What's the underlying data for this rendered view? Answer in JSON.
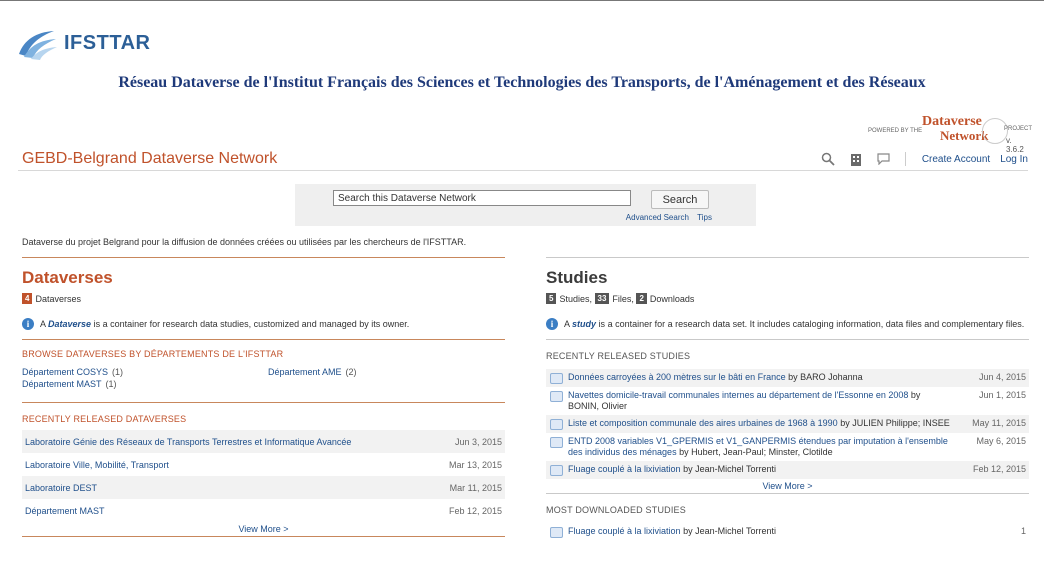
{
  "logo": {
    "text": "IFSTTAR"
  },
  "banner": {
    "title": "Réseau Dataverse de l'Institut Français des Sciences et Technologies des Transports, de l'Aménagement et des Réseaux"
  },
  "powered": {
    "pre": "POWERED BY THE",
    "line1": "Dataverse",
    "line2": "Network",
    "post": "PROJECT",
    "version": "v. 3.6.2"
  },
  "header": {
    "title": "GEBD-Belgrand Dataverse Network",
    "create_account": "Create Account",
    "login": "Log In"
  },
  "search": {
    "placeholder": "Search this Dataverse Network",
    "value": "Search this Dataverse Network",
    "button": "Search",
    "advanced": "Advanced Search",
    "tips": "Tips"
  },
  "description": "Dataverse du projet Belgrand pour la diffusion de données créées ou utilisées par les chercheurs de l'IFSTTAR.",
  "dataverses": {
    "title": "Dataverses",
    "count": "4",
    "count_label": "Dataverses",
    "info_pre": "A",
    "info_term": "Dataverse",
    "info_post": "is a container for research data studies, customized and managed by its owner.",
    "browse_heading": "BROWSE DATAVERSES BY DÉPARTEMENTS DE L'IFSTTAR",
    "browse": [
      {
        "name": "Département COSYS",
        "count": "(1)"
      },
      {
        "name": "Département AME",
        "count": "(2)"
      },
      {
        "name": "Département MAST",
        "count": "(1)"
      }
    ],
    "recent_heading": "RECENTLY RELEASED DATAVERSES",
    "recent": [
      {
        "name": "Laboratoire Génie des Réseaux de Transports Terrestres et Informatique Avancée",
        "date": "Jun 3, 2015"
      },
      {
        "name": "Laboratoire Ville, Mobilité, Transport",
        "date": "Mar 13, 2015"
      },
      {
        "name": "Laboratoire DEST",
        "date": "Mar 11, 2015"
      },
      {
        "name": "Département MAST",
        "date": "Feb 12, 2015"
      }
    ],
    "view_more": "View More >"
  },
  "studies": {
    "title": "Studies",
    "studies_count": "5",
    "studies_label": "Studies,",
    "files_count": "33",
    "files_label": "Files,",
    "downloads_count": "2",
    "downloads_label": "Downloads",
    "info_pre": "A",
    "info_term": "study",
    "info_post": "is a container for a research data set. It includes cataloging information, data files and complementary files.",
    "recent_heading": "RECENTLY RELEASED STUDIES",
    "recent": [
      {
        "title": "Données carroyées à 200 mètres sur le bâti en France",
        "by": "by BARO Johanna",
        "date": "Jun 4, 2015"
      },
      {
        "title": "Navettes domicile-travail communales internes au département de l'Essonne en 2008",
        "by": "by BONIN, Olivier",
        "date": "Jun 1, 2015"
      },
      {
        "title": "Liste et composition communale des aires urbaines de 1968 à 1990",
        "by": "by JULIEN Philippe; INSEE",
        "date": "May 11, 2015"
      },
      {
        "title": "ENTD 2008 variables V1_GPERMIS et V1_GANPERMIS étendues par imputation à l'ensemble des individus des ménages",
        "by": "by Hubert, Jean-Paul; Minster, Clotilde",
        "date": "May 6, 2015"
      },
      {
        "title": "Fluage couplé à la lixiviation",
        "by": "by Jean-Michel Torrenti",
        "date": "Feb 12, 2015"
      }
    ],
    "view_more": "View More >",
    "downloaded_heading": "MOST DOWNLOADED STUDIES",
    "downloaded": [
      {
        "title": "Fluage couplé à la lixiviation",
        "by": "by Jean-Michel Torrenti",
        "count": "1"
      }
    ]
  }
}
